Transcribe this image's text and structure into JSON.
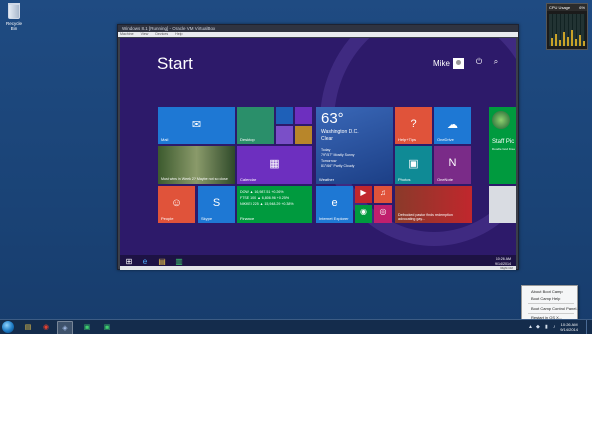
{
  "desktop": {
    "recycle_bin_label": "Recycle Bin",
    "gadget": {
      "title": "CPU Usage",
      "value": "6%"
    }
  },
  "vm_window": {
    "title": "Windows 8.1 [Running] - Oracle VM VirtualBox",
    "menus": [
      "Machine",
      "View",
      "Devices",
      "Help"
    ],
    "host_key": "Right Ctrl"
  },
  "start_screen": {
    "title": "Start",
    "user_name": "Mike",
    "tiles": {
      "mail": "Mail",
      "desktop": "Desktop",
      "help_tips": "Help+Tips",
      "onedrive": "OneDrive",
      "store_label": "Staff Pic",
      "store_sub": "Doodle God Free",
      "news_caption": "Must wins in Week 2? Maybe not so close",
      "calendar": "Calendar",
      "photos": "Photos",
      "onenote": "OneNote",
      "people": "People",
      "skype": "Skype",
      "finance": "Finance",
      "internet_explorer": "Internet Explorer",
      "news2_caption": "Defrocked pastor finds redemption advocating gay...",
      "weather": {
        "temp": "63°",
        "city": "Washington D.C.",
        "condition": "Clear",
        "today_label": "Today",
        "today": "79°/57° Mostly Sunny",
        "tomorrow_label": "Tomorrow",
        "tomorrow": "81°/66° Partly Cloudy",
        "label": "Weather"
      },
      "finance_rows": [
        {
          "name": "DOW",
          "value": "▲ 16,987.51 +0.26%"
        },
        {
          "name": "FTSE 100",
          "value": "▲ 6,806.96 +0.25%"
        },
        {
          "name": "NIKKEI 225",
          "value": "▲ 15,948.29 +0.38%"
        }
      ]
    },
    "clock": {
      "time": "10:26 AM",
      "date": "9/14/2014"
    }
  },
  "context_menu": {
    "items": [
      "About Boot Camp",
      "Boot Camp Help",
      "Boot Camp Control Panel...",
      "Restart in OS X..."
    ]
  },
  "taskbar": {
    "clock": {
      "time": "10:26 AM",
      "date": "9/14/2014"
    }
  },
  "colors": {
    "desktop_bg": "#1b4578",
    "start_bg": "#2d1a6a",
    "tile_blue": "#1e78d4",
    "tile_purple": "#6d2fbf",
    "tile_orange": "#e0533a",
    "tile_green": "#009a3e",
    "tile_red": "#c1272d"
  }
}
